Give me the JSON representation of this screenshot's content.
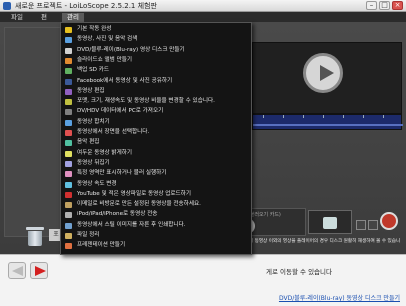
{
  "window": {
    "title": "새로운 프로젝트 - LoiLoScope 2.5.2.1 체험판"
  },
  "menubar": {
    "items": [
      "파일",
      "편",
      "관리"
    ]
  },
  "dropdown": {
    "items": [
      {
        "label": "기본 작동 완성",
        "color": "#e5c020"
      },
      {
        "label": "동영상, 사진 및 음악 검색",
        "color": "#5aa0e0"
      },
      {
        "label": "DVD/블루-레이(Blu-ray) 영상 디스크 만들기",
        "color": "#d0d0d0"
      },
      {
        "label": "슬라이드쇼 앨범 만들기",
        "color": "#e08a30"
      },
      {
        "label": "백업 SD 카드",
        "color": "#60b060"
      },
      {
        "label": "Facebook에서 동영상 및 사진 공유하기",
        "color": "#3b5998"
      },
      {
        "label": "동영상 편집",
        "color": "#9060c0"
      },
      {
        "label": "포맷, 크기, 재생속도 및 동영상 비율을 변경할 수 있습니다.",
        "color": "#c0c040"
      },
      {
        "label": "DV/HDV 데이터에서 PC로 가져오기",
        "color": "#808080"
      },
      {
        "label": "동영상 합치기",
        "color": "#5aa0e0"
      },
      {
        "label": "동영상에서 장면을 선택합니다.",
        "color": "#e05050"
      },
      {
        "label": "음악 편집",
        "color": "#50c0a0"
      },
      {
        "label": "여두운 동영상 밝게하기",
        "color": "#e0e060"
      },
      {
        "label": "동영상 뒤집기",
        "color": "#a0a0e0"
      },
      {
        "label": "특정 영역만 표시하거나 블러 실행하기",
        "color": "#e090c0"
      },
      {
        "label": "동영상 속도 변경",
        "color": "#60c0e0"
      },
      {
        "label": "YouTube 및 적은 영상파일로 동영상 업로드하기",
        "color": "#d03030"
      },
      {
        "label": "이메일로 비방문로 만든 설정된 동영상을 전송하세요.",
        "color": "#c0a060"
      },
      {
        "label": "iPod/iPad/iPhone로 동영상 전송",
        "color": "#b0b0b0"
      },
      {
        "label": "동영상에서 스틸 이미지를 자른 후 인쇄합니다.",
        "color": "#70a0d0"
      },
      {
        "label": "파일 정리",
        "color": "#d0b060"
      },
      {
        "label": "프레젠테이션 만들기",
        "color": "#e07040"
      }
    ]
  },
  "tools": {
    "cd_label": "(다시 불러오기 카드)",
    "description": "디스크에서 동영상 이외의 영상을 플레이어의 경우 디스크 원활히 재생하여 볼 수 있습니다."
  },
  "left_tab": "포",
  "wizard": {
    "hint": "게로 이동할 수 있습니다",
    "link": "DVD/블루-레이(Blu-ray) 동영상 디스크 만들기"
  }
}
